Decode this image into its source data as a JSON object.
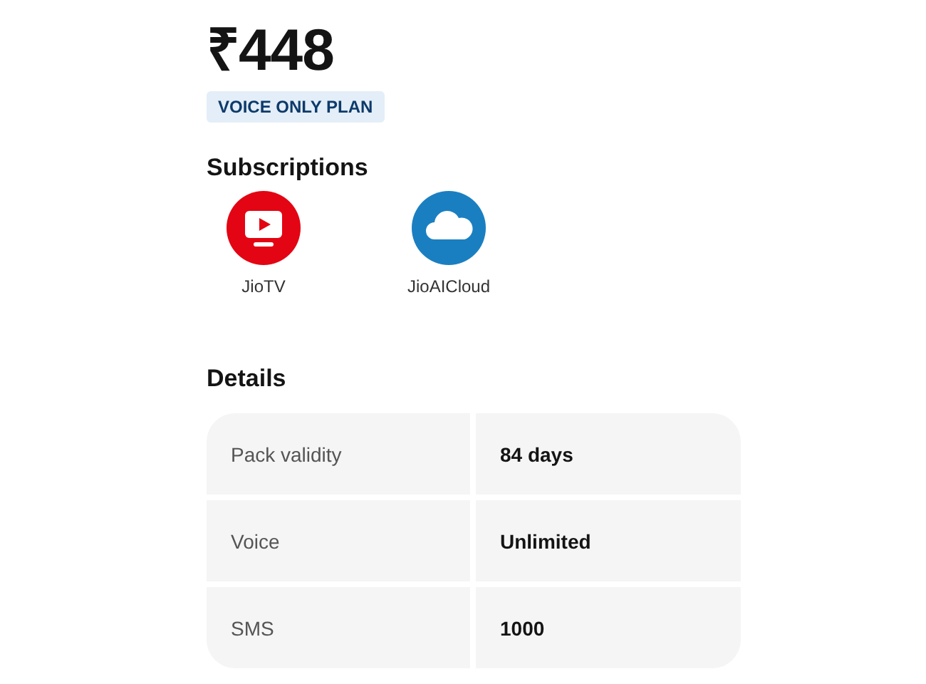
{
  "price": "₹448",
  "badge": "VOICE ONLY PLAN",
  "subscriptions": {
    "title": "Subscriptions",
    "items": [
      {
        "name": "JioTV",
        "kind": "tv",
        "color": "#e30513"
      },
      {
        "name": "JioAICloud",
        "kind": "cloud",
        "color": "#1a7fc1"
      }
    ]
  },
  "details": {
    "title": "Details",
    "rows": [
      {
        "label": "Pack validity",
        "value": "84 days"
      },
      {
        "label": "Voice",
        "value": "Unlimited"
      },
      {
        "label": "SMS",
        "value": "1000"
      }
    ]
  }
}
